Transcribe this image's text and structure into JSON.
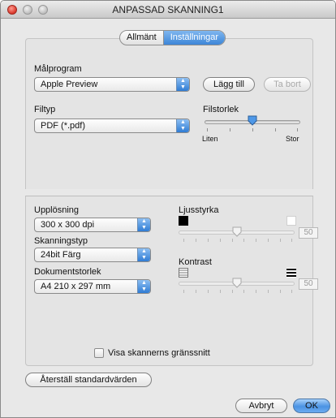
{
  "window": {
    "title": "ANPASSAD SKANNING1"
  },
  "tabs": [
    {
      "label": "Allmänt",
      "selected": false
    },
    {
      "label": "Inställningar",
      "selected": true
    }
  ],
  "target": {
    "label": "Målprogram",
    "value": "Apple Preview",
    "add_button": "Lägg till",
    "remove_button": "Ta bort"
  },
  "filetype": {
    "label": "Filtyp",
    "value": "PDF (*.pdf)"
  },
  "filesize": {
    "label": "Filstorlek",
    "min_label": "Liten",
    "max_label": "Stor",
    "level": 0.5
  },
  "resolution": {
    "label": "Upplösning",
    "value": "300 x 300 dpi"
  },
  "scan_type": {
    "label": "Skanningstyp",
    "value": "24bit Färg"
  },
  "doc_size": {
    "label": "Dokumentstorlek",
    "value": "A4  210 x 297 mm"
  },
  "brightness": {
    "label": "Ljusstyrka",
    "value": "50",
    "level": 0.5
  },
  "contrast": {
    "label": "Kontrast",
    "value": "50",
    "level": 0.5
  },
  "show_scanner_ui": {
    "label": "Visa skannerns gränssnitt",
    "checked": false
  },
  "buttons": {
    "restore_defaults": "Återställ standardvärden",
    "cancel": "Avbryt",
    "ok": "OK"
  },
  "colors": {
    "accent": "#3d86d8"
  }
}
